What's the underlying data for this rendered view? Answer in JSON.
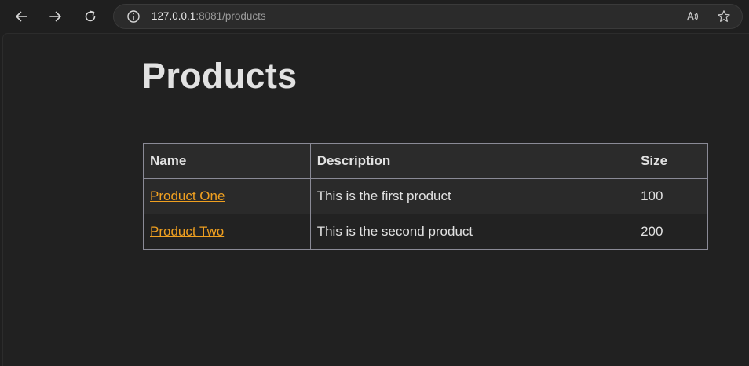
{
  "browser": {
    "url_host": "127.0.0.1",
    "url_rest": ":8081/products",
    "icons": {
      "back": "back-arrow-icon",
      "forward": "forward-arrow-icon",
      "reload": "reload-icon",
      "info": "info-icon",
      "read_aloud": "read-aloud-icon",
      "favorite": "star-icon"
    }
  },
  "page": {
    "title": "Products",
    "table": {
      "headers": [
        "Name",
        "Description",
        "Size"
      ],
      "rows": [
        {
          "name": "Product One",
          "description": "This is the first product",
          "size": "100"
        },
        {
          "name": "Product Two",
          "description": "This is the second product",
          "size": "200"
        }
      ]
    }
  },
  "colors": {
    "background": "#212121",
    "link": "#f0a020",
    "text": "#e2e2e2",
    "border": "#8a8a96"
  }
}
